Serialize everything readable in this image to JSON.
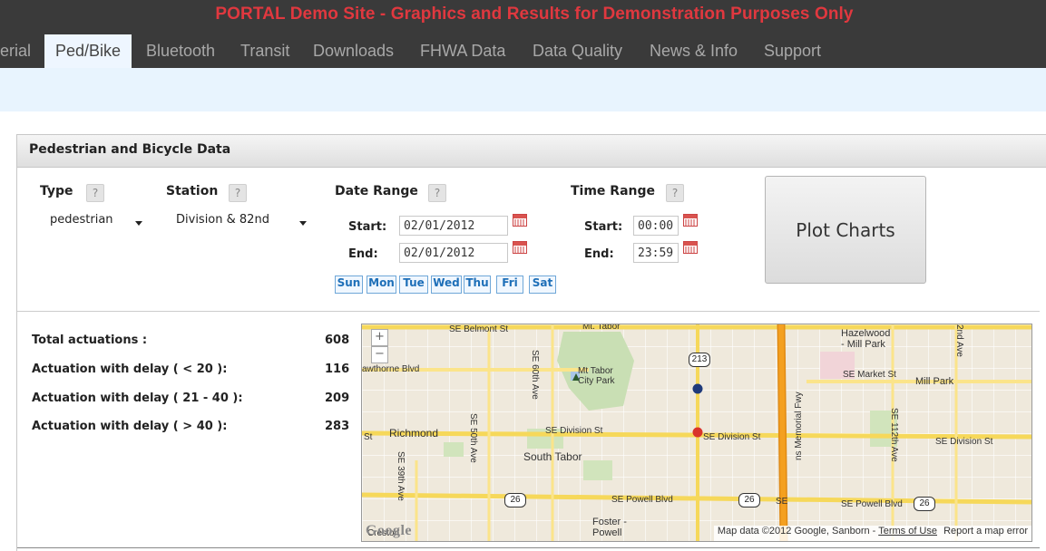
{
  "banner": "PORTAL Demo Site - Graphics and Results for Demonstration Purposes Only",
  "nav": [
    {
      "label": "erial"
    },
    {
      "label": "Ped/Bike",
      "active": true
    },
    {
      "label": "Bluetooth"
    },
    {
      "label": "Transit"
    },
    {
      "label": "Downloads"
    },
    {
      "label": "FHWA Data"
    },
    {
      "label": "Data Quality"
    },
    {
      "label": "News & Info"
    },
    {
      "label": "Support"
    }
  ],
  "panel": {
    "title": "Pedestrian and Bicycle Data"
  },
  "form": {
    "help": "?",
    "type_label": "Type",
    "type_value": "pedestrian",
    "station_label": "Station",
    "station_value": "Division & 82nd",
    "date_range_label": "Date Range",
    "time_range_label": "Time Range",
    "start_label": "Start:",
    "end_label": "End:",
    "date_start": "02/01/2012",
    "date_end": "02/01/2012",
    "time_start": "00:00",
    "time_end": "23:59",
    "days": [
      "Sun",
      "Mon",
      "Tue",
      "Wed",
      "Thu",
      "Fri",
      "Sat"
    ],
    "plot_label": "Plot Charts"
  },
  "stats": [
    {
      "label": "Total actuations :",
      "value": "608"
    },
    {
      "label": "Actuation with delay ( < 20 ):",
      "value": "116"
    },
    {
      "label": "Actuation with delay ( 21 - 40 ):",
      "value": "209"
    },
    {
      "label": "Actuation with delay ( > 40 ):",
      "value": "283"
    }
  ],
  "map": {
    "zoom_in": "+",
    "zoom_out": "−",
    "streets": {
      "belmont": "SE Belmont St",
      "mt_tabor_top": "Mt. Tabor",
      "hawthorne": "awthorne Blvd",
      "sixtieth": "SE 60th Ave",
      "division_center": "SE Division St",
      "division_right": "SE Division St",
      "division_far": "SE Division St",
      "fiftieth": "SE 50th Ave",
      "thirtyninth": "SE 39th Ave",
      "powell": "SE Powell Blvd",
      "powell_right": "SE Powell Blvd",
      "market": "SE Market St",
      "twelfth": "SE 112th Ave",
      "second": "2nd Ave",
      "memorial": "ns Memorial Fwy",
      "se_partial": "SE",
      "st_partial": "St"
    },
    "places": {
      "mt_tabor_park": "Mt Tabor\nCity Park",
      "hazelwood": "Hazelwood\n- Mill Park",
      "mill_park": "Mill Park",
      "richmond": "Richmond",
      "south_tabor": "South Tabor",
      "foster_powell": "Foster -\nPowell",
      "creston": "Creston"
    },
    "shields": {
      "r213": "213",
      "r26_left": "26",
      "r26_mid": "26",
      "r26_right": "26"
    },
    "logo": "Google",
    "attribution": "Map data ©2012 Google, Sanborn -",
    "terms": "Terms of Use",
    "report": "Report a map error",
    "colors": {
      "marker_blue": "#1f3a7a",
      "marker_red": "#d9342b",
      "freeway": "#f4a020"
    }
  }
}
